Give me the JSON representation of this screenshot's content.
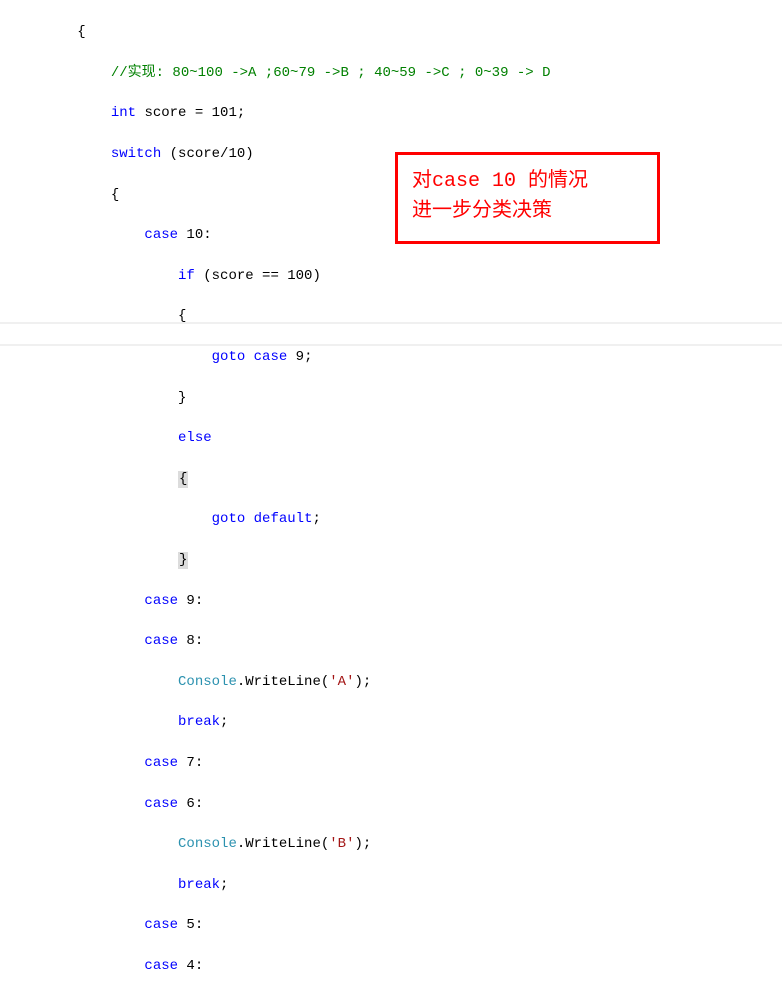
{
  "code": {
    "l00": "        {",
    "l01_a": "            ",
    "l01_b": "//实现: 80~100 ->A ;60~79 ->B ; 40~59 ->C ; 0~39 -> D",
    "l02_a": "            ",
    "l02_b": "int",
    "l02_c": " score = 101;",
    "l03_a": "            ",
    "l03_b": "switch",
    "l03_c": " (score/10)",
    "l04": "            {",
    "l05_a": "                ",
    "l05_b": "case",
    "l05_c": " 10:",
    "l06_a": "                    ",
    "l06_b": "if",
    "l06_c": " (score == 100)",
    "l07": "                    {",
    "l08_a": "                        ",
    "l08_b": "goto",
    "l08_c": " ",
    "l08_d": "case",
    "l08_e": " 9;",
    "l09": "                    }",
    "l10_a": "                    ",
    "l10_b": "else",
    "l11_a": "                    ",
    "l11_b": "{",
    "l12_a": "                        ",
    "l12_b": "goto",
    "l12_c": " ",
    "l12_d": "default",
    "l12_e": ";",
    "l13_a": "                    ",
    "l13_b": "}",
    "l14_a": "                ",
    "l14_b": "case",
    "l14_c": " 9:",
    "l15_a": "                ",
    "l15_b": "case",
    "l15_c": " 8:",
    "l16_a": "                    ",
    "l16_b": "Console",
    "l16_c": ".WriteLine(",
    "l16_d": "'A'",
    "l16_e": ");",
    "l17_a": "                    ",
    "l17_b": "break",
    "l17_c": ";",
    "l18_a": "                ",
    "l18_b": "case",
    "l18_c": " 7:",
    "l19_a": "                ",
    "l19_b": "case",
    "l19_c": " 6:",
    "l20_a": "                    ",
    "l20_b": "Console",
    "l20_c": ".WriteLine(",
    "l20_d": "'B'",
    "l20_e": ");",
    "l21_a": "                    ",
    "l21_b": "break",
    "l21_c": ";",
    "l22_a": "                ",
    "l22_b": "case",
    "l22_c": " 5:",
    "l23_a": "                ",
    "l23_b": "case",
    "l23_c": " 4:"
  },
  "callout": {
    "line1": "对case 10 的情况",
    "line2": "进一步分类决策"
  }
}
